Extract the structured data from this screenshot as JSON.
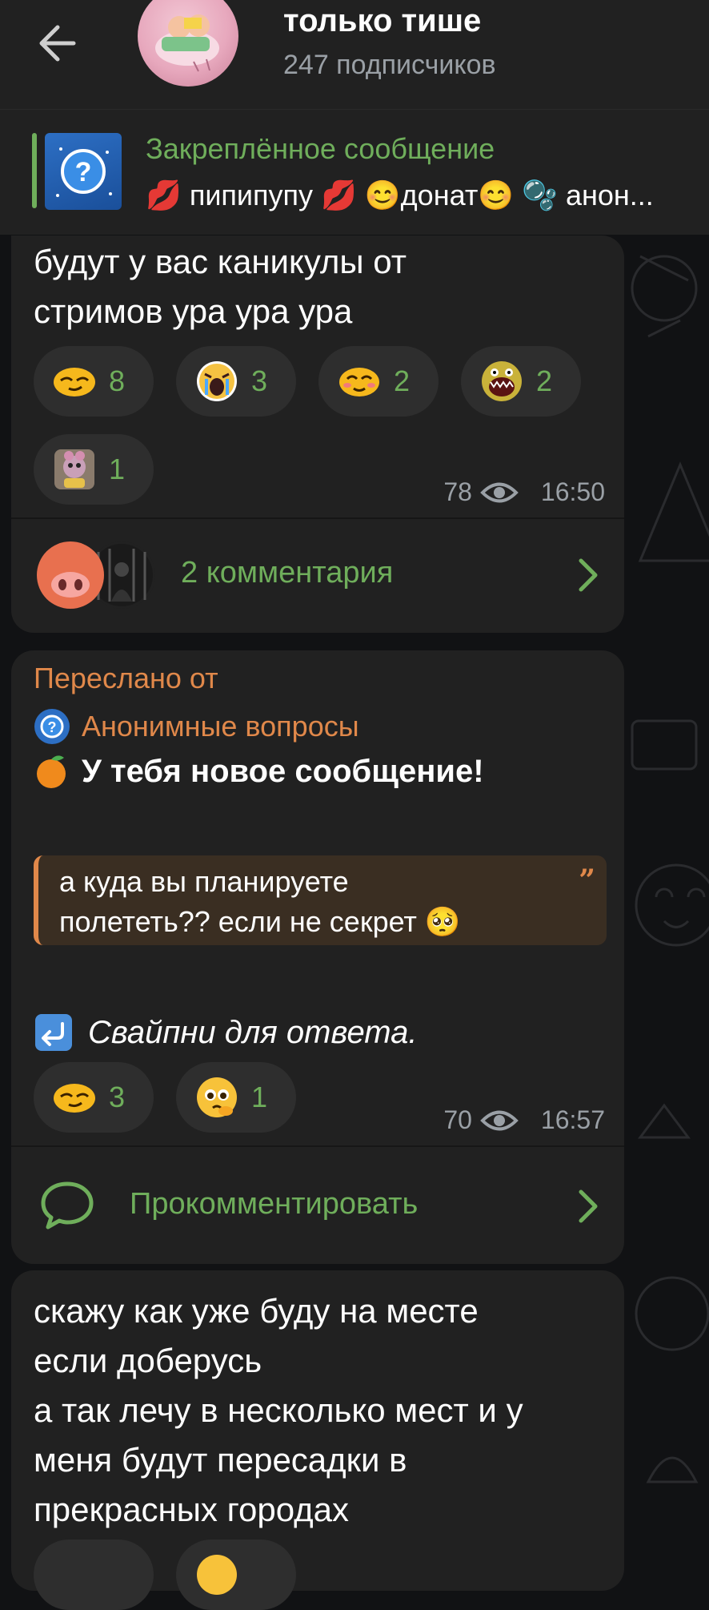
{
  "header": {
    "title": "только тише",
    "subtitle": "247 подписчиков"
  },
  "pinned": {
    "title": "Закреплённое сообщение",
    "text": "💋 пипипупу 💋 😊донат😊 🫧 анон..."
  },
  "messages": [
    {
      "text": "будут у вас каникулы от\nстримов ура ура ура",
      "reactions": [
        {
          "emoji": "smug-face",
          "count": "8"
        },
        {
          "emoji": "crying-face",
          "count": "3"
        },
        {
          "emoji": "blushing-face",
          "count": "2"
        },
        {
          "emoji": "monster-face",
          "count": "2"
        },
        {
          "emoji": "sticker-toy",
          "count": "1"
        }
      ],
      "views": "78",
      "time": "16:50",
      "comments_label": "2 комментария"
    },
    {
      "forwarded_label": "Переслано от",
      "forwarded_from": "Анонимные вопросы",
      "headline": "У тебя новое сообщение!",
      "quote": "а куда вы планируете\nполететь?? если не секрет 🥺",
      "swipe_hint": "Свайпни для ответа.",
      "reactions": [
        {
          "emoji": "smug-face",
          "count": "3"
        },
        {
          "emoji": "pleading-face",
          "count": "1"
        }
      ],
      "views": "70",
      "time": "16:57",
      "comment_action": "Прокомментировать"
    },
    {
      "text": "скажу как уже буду на месте\nесли доберусь\nа так лечу в несколько мест и у\nменя будут пересадки в\nпрекрасных городах"
    }
  ],
  "colors": {
    "accent_green": "#6fae5b",
    "forward_orange": "#e0884a",
    "bubble": "#212121",
    "background": "#111214"
  }
}
